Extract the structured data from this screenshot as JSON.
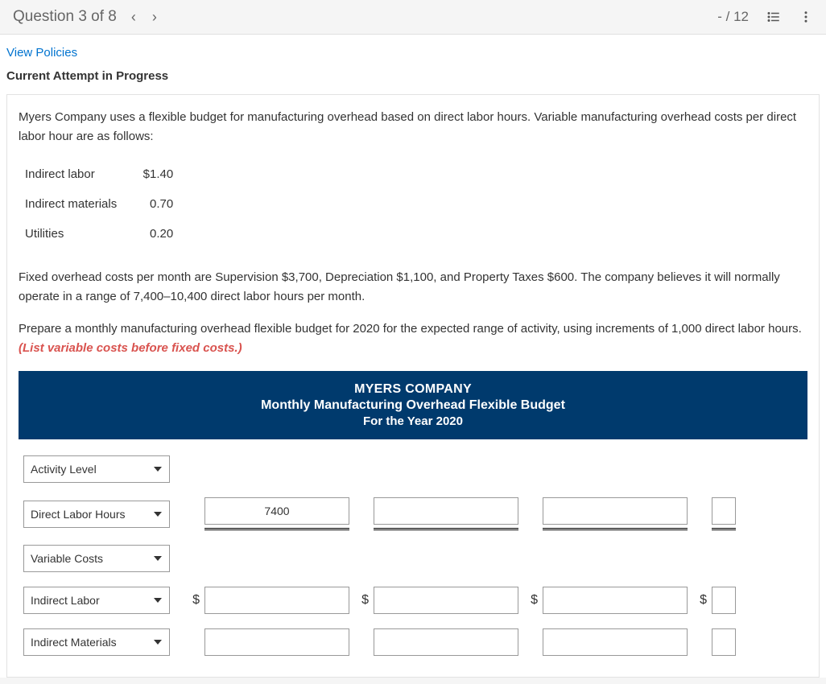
{
  "header": {
    "question_label": "Question 3 of 8",
    "score": "- / 12"
  },
  "links": {
    "view_policies": "View Policies"
  },
  "attempt_heading": "Current Attempt in Progress",
  "intro_para": "Myers Company uses a flexible budget for manufacturing overhead based on direct labor hours. Variable manufacturing overhead costs per direct labor hour are as follows:",
  "cost_rows": [
    {
      "label": "Indirect labor",
      "amount": "$1.40"
    },
    {
      "label": "Indirect materials",
      "amount": "0.70"
    },
    {
      "label": "Utilities",
      "amount": "0.20"
    }
  ],
  "fixed_para": "Fixed overhead costs per month are Supervision $3,700, Depreciation $1,100, and Property Taxes $600. The company believes it will normally operate in a range of 7,400–10,400 direct labor hours per month.",
  "instruction_lead": "Prepare a monthly manufacturing overhead flexible budget for 2020 for the expected range of activity, using increments of 1,000 direct labor hours. ",
  "instruction_red": "(List variable costs before fixed costs.)",
  "banner": {
    "line1": "MYERS COMPANY",
    "line2": "Monthly Manufacturing Overhead Flexible Budget",
    "line3": "For the Year 2020"
  },
  "rows": {
    "r1_select": "Activity Level",
    "r2_select": "Direct Labor Hours",
    "r2_val1": "7400",
    "r3_select": "Variable Costs",
    "r4_select": "Indirect Labor",
    "r5_select": "Indirect Materials"
  },
  "dollar": "$"
}
